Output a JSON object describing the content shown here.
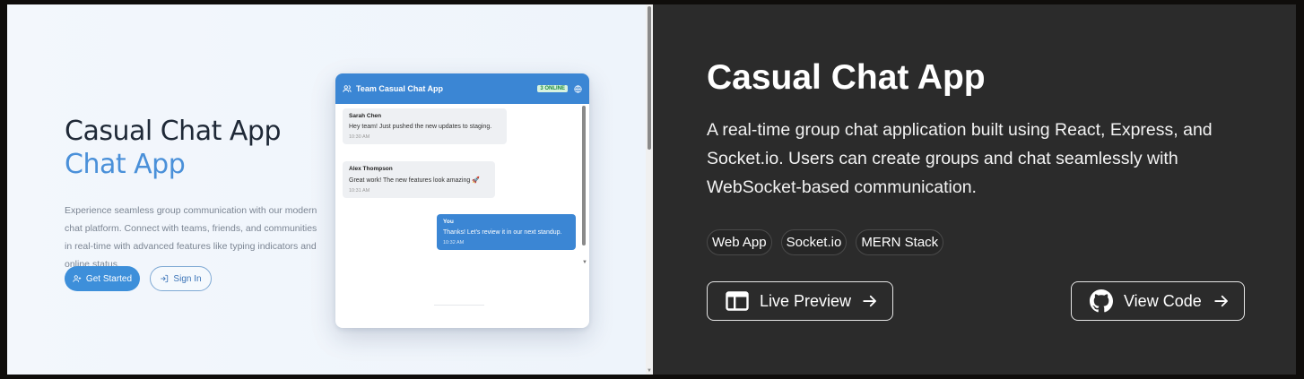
{
  "preview": {
    "hero_title": "Casual Chat App",
    "hero_subtitle": "Chat App",
    "hero_description": "Experience seamless group communication with our modern chat platform. Connect with teams, friends, and communities in real-time with advanced features like typing indicators and online status.",
    "get_started_label": "Get Started",
    "sign_in_label": "Sign In",
    "chat": {
      "room_name": "Team Casual Chat App",
      "online_badge": "3 ONLINE",
      "messages": [
        {
          "sender": "Sarah Chen",
          "text": "Hey team! Just pushed the new updates to staging.",
          "time": "10:30 AM",
          "direction": "in"
        },
        {
          "sender": "Alex Thompson",
          "text": "Great work! The new features look amazing 🚀",
          "time": "10:31 AM",
          "direction": "in"
        },
        {
          "sender": "You",
          "text": "Thanks! Let's review it in our next standup.",
          "time": "10:32 AM",
          "direction": "out"
        }
      ]
    }
  },
  "info": {
    "title": "Casual Chat App",
    "description": "A real-time group chat application built using React, Express, and Socket.io. Users can create groups and chat seamlessly with WebSocket-based communication.",
    "tags": [
      "Web App",
      "Socket.io",
      "MERN Stack"
    ],
    "live_preview_label": "Live Preview",
    "view_code_label": "View Code"
  },
  "colors": {
    "accent": "#3b86d4",
    "dark_panel": "#2b2b2b",
    "online_green": "#1c8a3c"
  },
  "icons": {
    "get_started": "user-plus-icon",
    "sign_in": "log-in-icon",
    "chat_header": "users-icon",
    "chat_globe": "globe-icon",
    "live_preview": "browser-window-icon",
    "view_code": "github-icon",
    "arrow": "arrow-right-icon"
  }
}
